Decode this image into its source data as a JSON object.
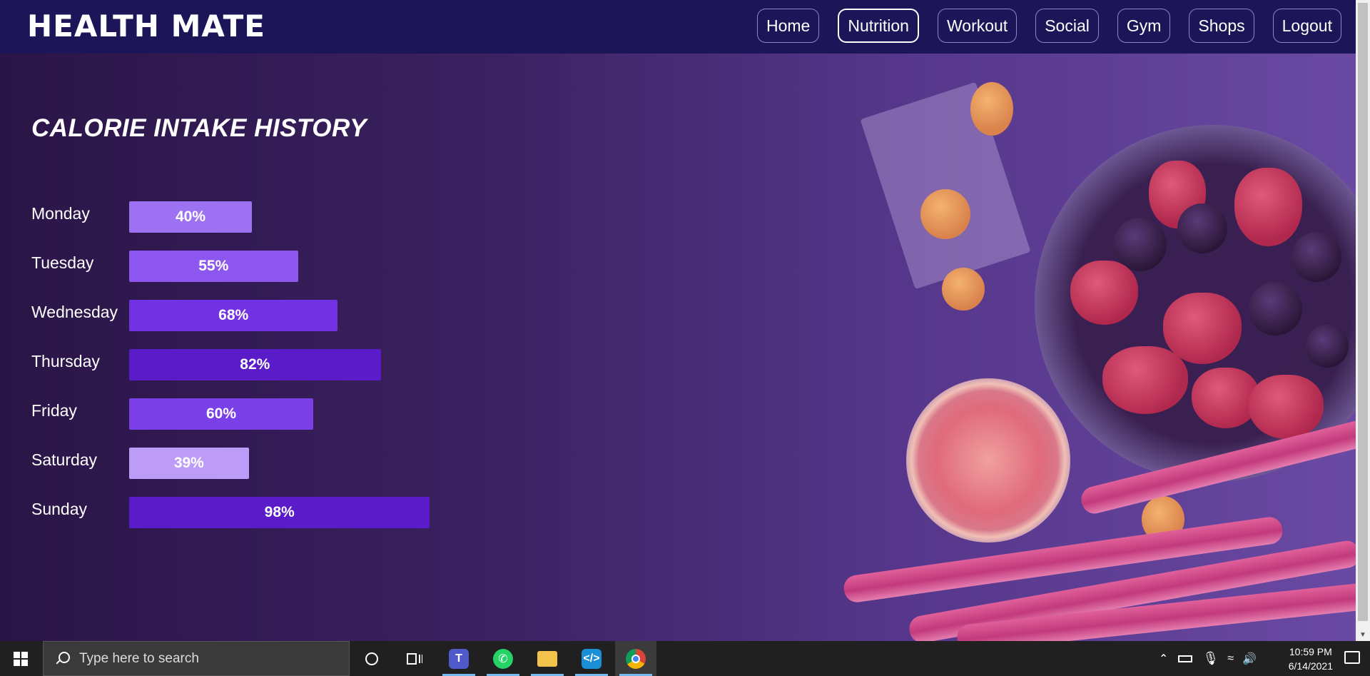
{
  "navbar": {
    "brand": "HEALTH MATE",
    "items": [
      {
        "label": "Home",
        "active": false
      },
      {
        "label": "Nutrition",
        "active": true
      },
      {
        "label": "Workout",
        "active": false
      },
      {
        "label": "Social",
        "active": false
      },
      {
        "label": "Gym",
        "active": false
      },
      {
        "label": "Shops",
        "active": false
      },
      {
        "label": "Logout",
        "active": false
      }
    ]
  },
  "main": {
    "title": "CALORIE INTAKE HISTORY"
  },
  "chart_data": {
    "type": "bar",
    "orientation": "horizontal",
    "title": "CALORIE INTAKE HISTORY",
    "categories": [
      "Monday",
      "Tuesday",
      "Wednesday",
      "Thursday",
      "Friday",
      "Saturday",
      "Sunday"
    ],
    "values": [
      40,
      55,
      68,
      82,
      60,
      39,
      98
    ],
    "value_labels": [
      "40%",
      "55%",
      "68%",
      "82%",
      "60%",
      "39%",
      "98%"
    ],
    "bar_colors": [
      "#9d72f2",
      "#8d57ef",
      "#7232e4",
      "#5a1bc9",
      "#7a3fe6",
      "#bc9cf7",
      "#5a1bc9"
    ],
    "xlim": [
      0,
      100
    ],
    "grid": false
  },
  "taskbar": {
    "search_placeholder": "Type here to search",
    "apps": [
      "teams-icon",
      "whatsapp-icon",
      "file-explorer-icon",
      "vscode-icon",
      "chrome-icon"
    ],
    "time": "10:59 PM",
    "date": "6/14/2021"
  },
  "colors": {
    "navbar": "#1c1659",
    "taskbar": "#202020"
  }
}
